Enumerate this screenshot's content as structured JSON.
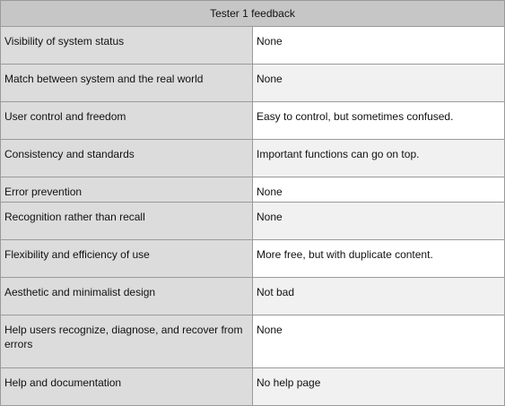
{
  "table": {
    "header": "Tester 1 feedback",
    "rows": [
      {
        "criterion": "Visibility of system status",
        "feedback": "None"
      },
      {
        "criterion": "Match between system and the real world",
        "feedback": "None"
      },
      {
        "criterion": "User control and freedom",
        "feedback": "Easy to control, but sometimes confused."
      },
      {
        "criterion": "Consistency and standards",
        "feedback": "Important functions can go on top."
      },
      {
        "criterion": "Error prevention",
        "feedback": "None"
      },
      {
        "criterion": "Recognition rather than recall",
        "feedback": "None"
      },
      {
        "criterion": "Flexibility and efficiency of use",
        "feedback": "More free, but with duplicate content."
      },
      {
        "criterion": "Aesthetic and minimalist design",
        "feedback": "Not bad"
      },
      {
        "criterion": "Help users recognize, diagnose, and recover from errors",
        "feedback": "None"
      },
      {
        "criterion": "Help and documentation",
        "feedback": "No help page"
      }
    ]
  }
}
